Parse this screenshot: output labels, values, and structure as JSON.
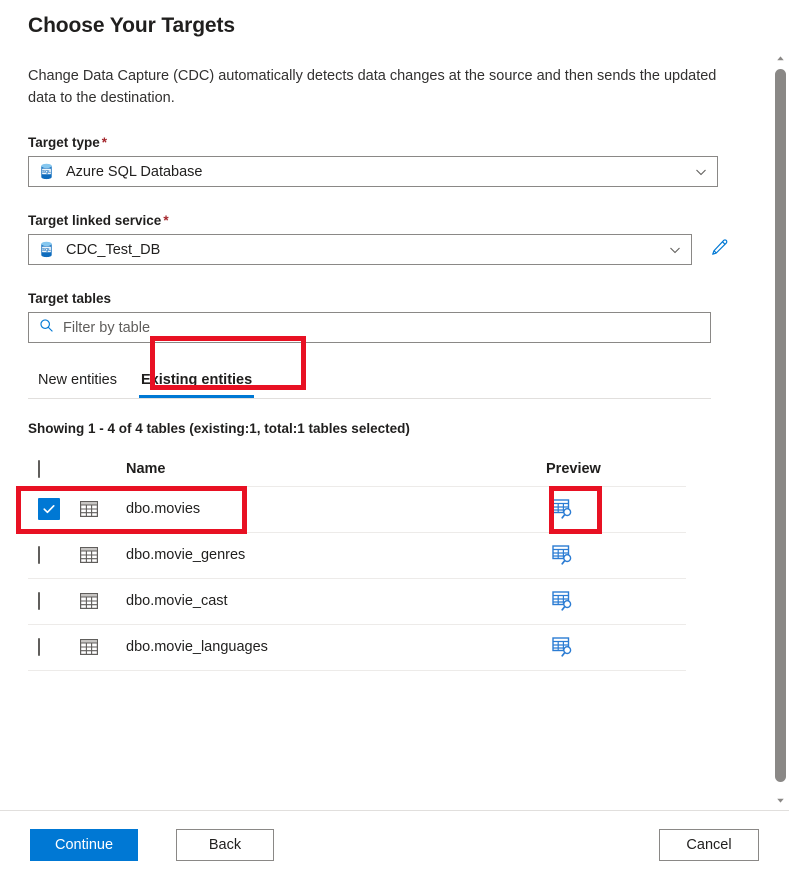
{
  "header": {
    "title": "Choose Your Targets",
    "description": "Change Data Capture (CDC) automatically detects data changes at the source and then sends the updated data to the destination."
  },
  "fields": {
    "target_type": {
      "label": "Target type",
      "required_marker": "*",
      "value": "Azure SQL Database",
      "icon": "azure-sql-database-icon",
      "chevron": "chevron-down-icon"
    },
    "target_linked_service": {
      "label": "Target linked service",
      "required_marker": "*",
      "value": "CDC_Test_DB",
      "icon": "azure-sql-database-icon",
      "chevron": "chevron-down-icon",
      "edit_icon": "pencil-icon"
    },
    "target_tables": {
      "label": "Target tables",
      "search_placeholder": "Filter by table",
      "search_value": "",
      "search_icon": "search-icon"
    }
  },
  "tabs": [
    {
      "label": "New entities",
      "active": false
    },
    {
      "label": "Existing entities",
      "active": true
    }
  ],
  "status": {
    "showing": "Showing 1 - 4 of 4 tables (existing:1, total:1 tables selected)"
  },
  "table": {
    "columns": [
      "",
      "",
      "Name",
      "Preview"
    ],
    "header_checkbox_checked": false,
    "rows": [
      {
        "checked": true,
        "icon": "table-grid-icon",
        "name": "dbo.movies",
        "preview_icon": "preview-table-icon"
      },
      {
        "checked": false,
        "icon": "table-grid-icon",
        "name": "dbo.movie_genres",
        "preview_icon": "preview-table-icon"
      },
      {
        "checked": false,
        "icon": "table-grid-icon",
        "name": "dbo.movie_cast",
        "preview_icon": "preview-table-icon"
      },
      {
        "checked": false,
        "icon": "table-grid-icon",
        "name": "dbo.movie_languages",
        "preview_icon": "preview-table-icon"
      }
    ]
  },
  "footer": {
    "continue_label": "Continue",
    "back_label": "Back",
    "cancel_label": "Cancel"
  },
  "scrollbar": {
    "up_icon": "scroll-up-arrow-icon",
    "down_icon": "scroll-down-arrow-icon"
  },
  "colors": {
    "accent": "#0078d4",
    "required": "#a4262c",
    "annotation": "#e81123",
    "border": "#8a8886",
    "divider": "#e1dfdd"
  }
}
